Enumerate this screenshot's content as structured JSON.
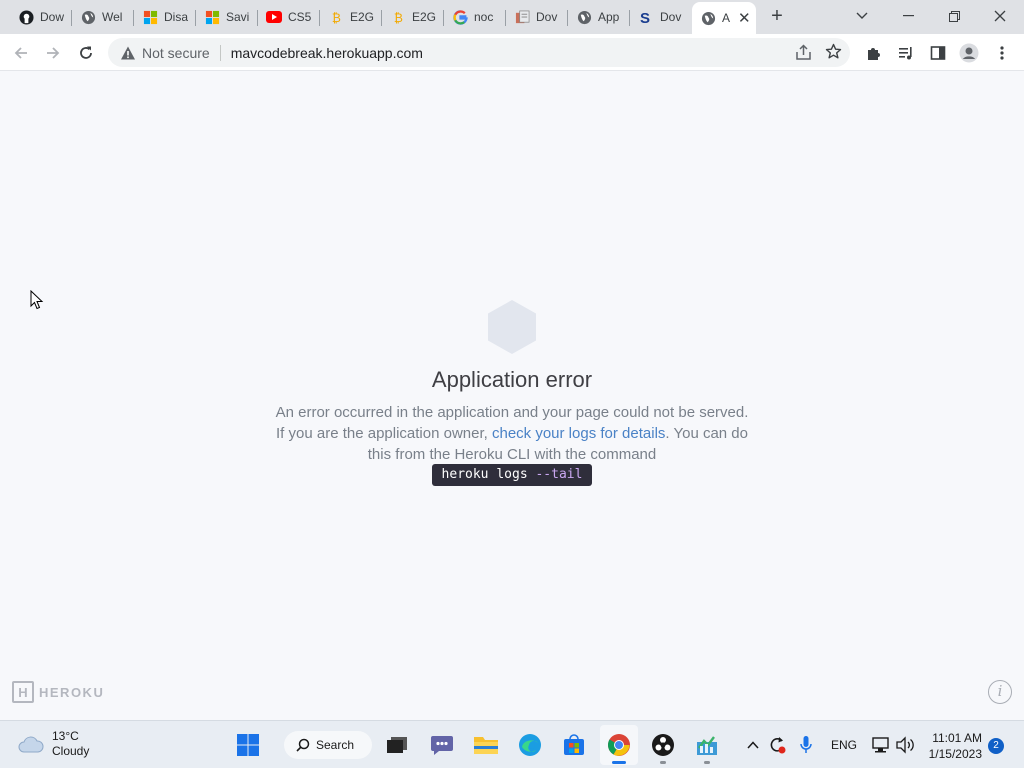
{
  "browser": {
    "tabs": [
      {
        "title": "Dow",
        "icon": "github-icon"
      },
      {
        "title": "Wel",
        "icon": "globe-icon"
      },
      {
        "title": "Disa",
        "icon": "microsoft-icon"
      },
      {
        "title": "Savi",
        "icon": "microsoft-icon"
      },
      {
        "title": "CS5",
        "icon": "youtube-icon"
      },
      {
        "title": "E2G",
        "icon": "bitcoin-icon"
      },
      {
        "title": "E2G",
        "icon": "bitcoin-icon"
      },
      {
        "title": "noc",
        "icon": "google-icon"
      },
      {
        "title": "Dov",
        "icon": "doc-icon"
      },
      {
        "title": "App",
        "icon": "globe-icon"
      },
      {
        "title": "Dov",
        "icon": "s-icon"
      },
      {
        "title": "A",
        "icon": "globe-icon",
        "active": true
      }
    ],
    "new_tab": "+",
    "address": {
      "security": "Not secure",
      "url": "mavcodebreak.herokuapp.com"
    }
  },
  "page": {
    "title": "Application error",
    "message_part1": "An error occurred in the application and your page could not be served. If you are the application owner, ",
    "link_text": "check your logs for details",
    "message_part2": ". You can do this from the Heroku CLI with the command",
    "command_main": "heroku logs ",
    "command_flag": "--tail",
    "brand": "HEROKU",
    "brand_mark": "H"
  },
  "taskbar": {
    "weather_temp": "13°C",
    "weather_desc": "Cloudy",
    "search_label": "Search",
    "language": "ENG",
    "time": "11:01 AM",
    "date": "1/15/2023",
    "notification_count": "2"
  },
  "colors": {
    "link": "#4a82c6",
    "command_bg": "#2f2e3b",
    "hexagon": "#e2e6ee",
    "notification": "#1060c7"
  }
}
